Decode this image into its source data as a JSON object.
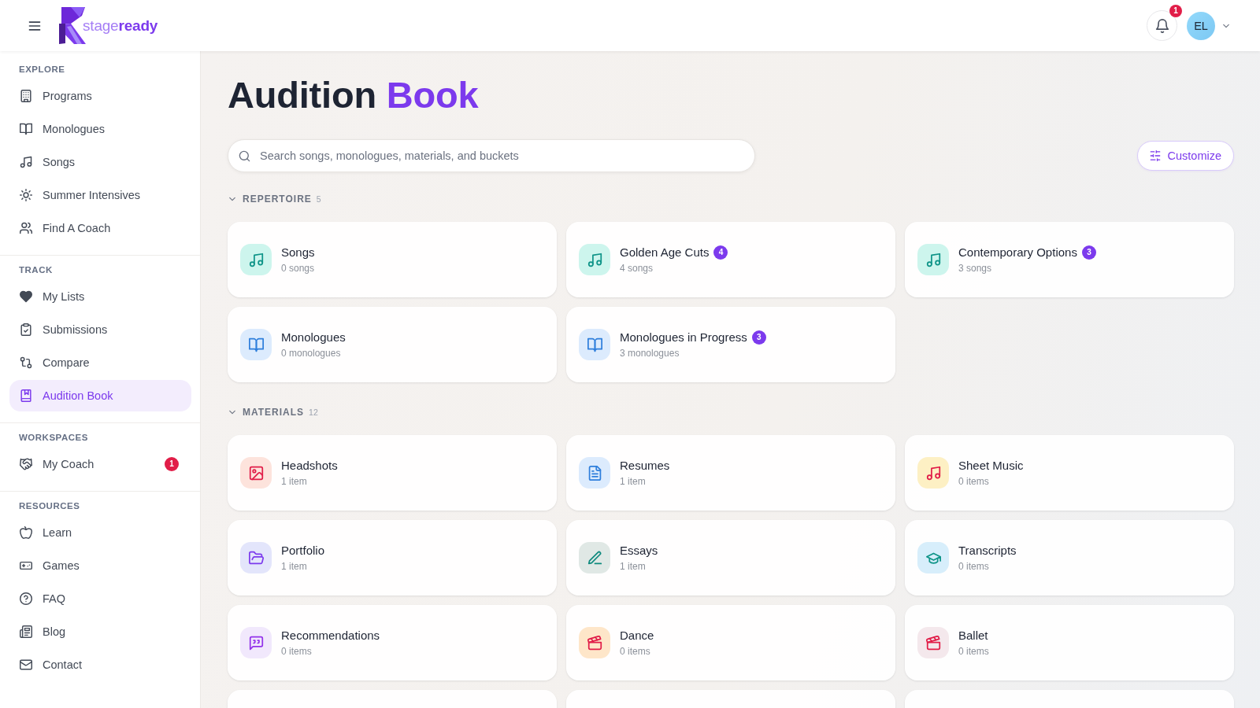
{
  "header": {
    "logo": {
      "text": "stage**ready**"
    },
    "notifications": {
      "count": "1"
    },
    "user": {
      "initials": "EL"
    }
  },
  "sidebar": {
    "sections": [
      {
        "label": "EXPLORE",
        "items": [
          {
            "kind": "building",
            "label": "Programs",
            "selected": false
          },
          {
            "kind": "book",
            "label": "Monologues",
            "selected": false
          },
          {
            "kind": "music",
            "label": "Songs",
            "selected": false
          },
          {
            "kind": "sun",
            "label": "Summer Intensives",
            "selected": false
          },
          {
            "kind": "users",
            "label": "Find A Coach",
            "selected": false
          }
        ]
      },
      {
        "label": "TRACK",
        "items": [
          {
            "kind": "heart",
            "label": "My Lists",
            "selected": false
          },
          {
            "kind": "clipboard",
            "label": "Submissions",
            "selected": false
          },
          {
            "kind": "compare",
            "label": "Compare",
            "selected": false
          },
          {
            "kind": "bookmark",
            "label": "Audition Book",
            "selected": true
          }
        ]
      },
      {
        "label": "WORKSPACES",
        "items": [
          {
            "kind": "handshake",
            "label": "My Coach",
            "selected": false,
            "badge": "1"
          }
        ]
      },
      {
        "label": "RESOURCES",
        "items": [
          {
            "kind": "apple",
            "label": "Learn",
            "selected": false
          },
          {
            "kind": "gamepad",
            "label": "Games",
            "selected": false
          },
          {
            "kind": "help",
            "label": "FAQ",
            "selected": false
          },
          {
            "kind": "newspaper",
            "label": "Blog",
            "selected": false
          },
          {
            "kind": "mail",
            "label": "Contact",
            "selected": false
          }
        ]
      }
    ]
  },
  "page": {
    "title": "Audition",
    "title_accent": "Book",
    "search": {
      "placeholder": "Search songs, monologues, materials, and buckets"
    },
    "customize_button": "Customize"
  },
  "sections": [
    {
      "label": "REPERTOIRE",
      "count": "5",
      "expanded": true,
      "cards": [
        {
          "kind": "song",
          "title": "Songs",
          "subtitle": "0 songs"
        },
        {
          "kind": "song",
          "title": "Golden Age Cuts",
          "badge": "4",
          "subtitle": "4 songs"
        },
        {
          "kind": "song",
          "title": "Contemporary Options",
          "badge": "3",
          "subtitle": "3 songs"
        },
        {
          "kind": "monologue",
          "title": "Monologues",
          "subtitle": "0 monologues"
        },
        {
          "kind": "monologue",
          "title": "Monologues in Progress",
          "badge": "3",
          "subtitle": "3 monologues"
        }
      ]
    },
    {
      "label": "MATERIALS",
      "count": "12",
      "expanded": true,
      "cards": [
        {
          "kind": "headshot",
          "title": "Headshots",
          "subtitle": "1 item"
        },
        {
          "kind": "resume",
          "title": "Resumes",
          "subtitle": "1 item"
        },
        {
          "kind": "sheet",
          "title": "Sheet Music",
          "subtitle": "0 items"
        },
        {
          "kind": "portfolio",
          "title": "Portfolio",
          "subtitle": "1 item"
        },
        {
          "kind": "essay",
          "title": "Essays",
          "subtitle": "1 item"
        },
        {
          "kind": "transcript",
          "title": "Transcripts",
          "subtitle": "0 items"
        },
        {
          "kind": "recommendation",
          "title": "Recommendations",
          "subtitle": "0 items"
        },
        {
          "kind": "dance",
          "title": "Dance",
          "subtitle": "0 items"
        },
        {
          "kind": "ballet",
          "title": "Ballet",
          "subtitle": "0 items"
        },
        {
          "kind": "clipped"
        },
        {
          "kind": "clipped"
        },
        {
          "kind": "clipped"
        }
      ]
    }
  ]
}
